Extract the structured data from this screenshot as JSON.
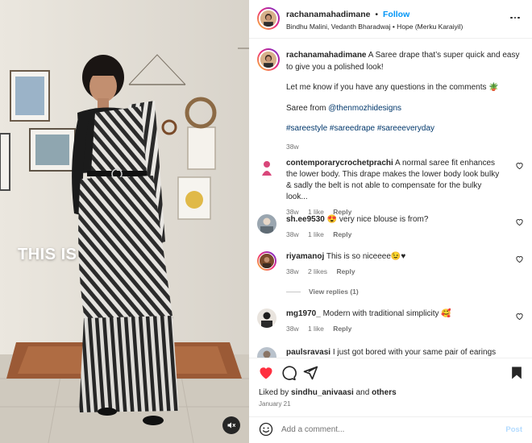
{
  "post": {
    "username": "rachanamahadimane",
    "follow_label": "Follow",
    "separator": "•",
    "audio_line": "Bindhu Malini, Vedanth Bharadwaj • Hope (Merku Karaiyil)",
    "more_icon": "more-horizontal-icon"
  },
  "media": {
    "overlay_text": "THIS IS",
    "mute_icon": "speaker-muted-icon"
  },
  "caption": {
    "username": "rachanamahadimane",
    "text_1": " A Saree drape that’s super quick and easy to give you a polished look!",
    "text_2": "Let me know if you have any questions in the comments 🪴",
    "text_3_prefix": "Saree from ",
    "mention": "@thenmozhidesigns",
    "hashtags": "#sareestyle #sareedrape #sareeeveryday",
    "time": "38w"
  },
  "comments": [
    {
      "username": "contemporarycrochetprachi",
      "text": " A normal saree fit enhances the lower body. This drape makes the lower body look bulky & sadly the belt is not able to compensate for the bulky look...",
      "time": "38w",
      "likes": "1 like",
      "reply": "Reply"
    },
    {
      "username": "sh.ee9530",
      "text": " 😍 very nice blouse is from?",
      "time": "38w",
      "likes": "1 like",
      "reply": "Reply"
    },
    {
      "username": "riyamanoj",
      "text": " This is so niceeee😉♥",
      "time": "38w",
      "likes": "2 likes",
      "reply": "Reply",
      "view_replies": "View replies (1)"
    },
    {
      "username": "mg1970_",
      "text": " Modern with traditional simplicity 🥰",
      "time": "38w",
      "likes": "1 like",
      "reply": "Reply"
    },
    {
      "username": "paulsravasi",
      "text": " I just got bored with your same pair of earings but",
      "time": "",
      "likes": "",
      "reply": ""
    }
  ],
  "actions": {
    "like_icon": "heart-filled-icon",
    "comment_icon": "comment-icon",
    "share_icon": "share-icon",
    "save_icon": "bookmark-icon",
    "liked_by_prefix": "Liked by ",
    "liked_by_user": "sindhu_anivaasi",
    "liked_by_mid": " and ",
    "liked_by_others": "others",
    "date": "January 21"
  },
  "add_comment": {
    "placeholder": "Add a comment...",
    "post_label": "Post",
    "emoji_icon": "emoji-icon"
  },
  "colors": {
    "accent_blue": "#0095f6",
    "like_red": "#ff3040",
    "muted_text": "#737373",
    "post_disabled": "#b3dbff"
  }
}
